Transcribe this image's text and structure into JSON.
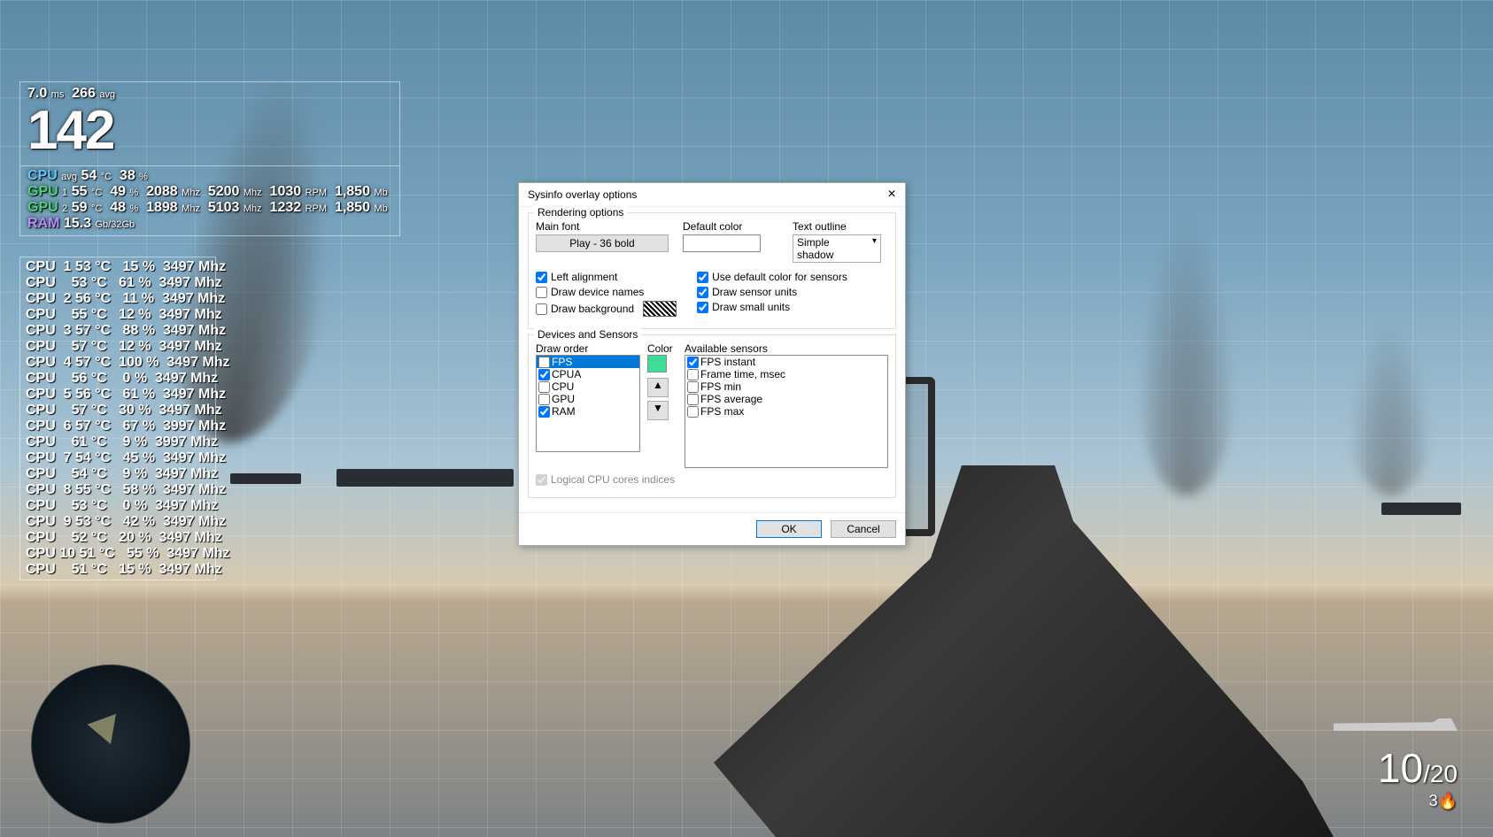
{
  "osd": {
    "frametime": {
      "value": "7.0",
      "unit": "ms",
      "avg": "266",
      "avg_unit": "avg"
    },
    "fps": "142",
    "cpu_avg": {
      "label": "CPU",
      "sub": "avg",
      "temp": "54",
      "temp_u": "°C",
      "load": "38",
      "load_u": "%"
    },
    "gpu1": {
      "label": "GPU",
      "idx": "1",
      "temp": "55",
      "temp_u": "°C",
      "load": "49",
      "load_u": "%",
      "core": "2088",
      "core_u": "Mhz",
      "mem": "5200",
      "mem_u": "Mhz",
      "fan": "1030",
      "fan_u": "RPM",
      "vram": "1,850",
      "vram_u": "Mb"
    },
    "gpu2": {
      "label": "GPU",
      "idx": "2",
      "temp": "59",
      "temp_u": "°C",
      "load": "48",
      "load_u": "%",
      "core": "1898",
      "core_u": "Mhz",
      "mem": "5103",
      "mem_u": "Mhz",
      "fan": "1232",
      "fan_u": "RPM",
      "vram": "1,850",
      "vram_u": "Mb"
    },
    "ram": {
      "label": "RAM",
      "value": "15.3",
      "unit": "Gb/32Gb"
    },
    "cores": [
      {
        "label": "CPU",
        "idx": "1",
        "temp": "53",
        "load": "15",
        "clk": "3497",
        "hot": false
      },
      {
        "label": "CPU",
        "idx": "",
        "temp": "53",
        "load": "61",
        "clk": "3497",
        "hot": false
      },
      {
        "label": "CPU",
        "idx": "2",
        "temp": "56",
        "load": "11",
        "clk": "3497",
        "hot": false
      },
      {
        "label": "CPU",
        "idx": "",
        "temp": "55",
        "load": "12",
        "clk": "3497",
        "hot": false
      },
      {
        "label": "CPU",
        "idx": "3",
        "temp": "57",
        "load": "88",
        "clk": "3497",
        "hot": true
      },
      {
        "label": "CPU",
        "idx": "",
        "temp": "57",
        "load": "12",
        "clk": "3497",
        "hot": false
      },
      {
        "label": "CPU",
        "idx": "4",
        "temp": "57",
        "load": "100",
        "clk": "3497",
        "hot": true
      },
      {
        "label": "CPU",
        "idx": "",
        "temp": "56",
        "load": "0",
        "clk": "3497",
        "hot": false
      },
      {
        "label": "CPU",
        "idx": "5",
        "temp": "56",
        "load": "61",
        "clk": "3497",
        "hot": false
      },
      {
        "label": "CPU",
        "idx": "",
        "temp": "57",
        "load": "30",
        "clk": "3497",
        "hot": false
      },
      {
        "label": "CPU",
        "idx": "6",
        "temp": "57",
        "load": "67",
        "clk": "3997",
        "hot": false
      },
      {
        "label": "CPU",
        "idx": "",
        "temp": "61",
        "load": "9",
        "clk": "3997",
        "hot": false
      },
      {
        "label": "CPU",
        "idx": "7",
        "temp": "54",
        "load": "45",
        "clk": "3497",
        "hot": false
      },
      {
        "label": "CPU",
        "idx": "",
        "temp": "54",
        "load": "9",
        "clk": "3497",
        "hot": false
      },
      {
        "label": "CPU",
        "idx": "8",
        "temp": "55",
        "load": "58",
        "clk": "3497",
        "hot": false
      },
      {
        "label": "CPU",
        "idx": "",
        "temp": "53",
        "load": "0",
        "clk": "3497",
        "hot": false
      },
      {
        "label": "CPU",
        "idx": "9",
        "temp": "53",
        "load": "42",
        "clk": "3497",
        "hot": false
      },
      {
        "label": "CPU",
        "idx": "",
        "temp": "52",
        "load": "20",
        "clk": "3497",
        "hot": false
      },
      {
        "label": "CPU",
        "idx": "10",
        "temp": "51",
        "load": "55",
        "clk": "3497",
        "hot": false
      },
      {
        "label": "CPU",
        "idx": "",
        "temp": "51",
        "load": "15",
        "clk": "3497",
        "hot": false
      }
    ],
    "core_units": {
      "temp": "°C",
      "load": "%",
      "clk": "Mhz"
    }
  },
  "hud": {
    "ammo_current": "10",
    "ammo_sep": "/",
    "ammo_reserve": "20",
    "ammo_sub": "3🔥"
  },
  "dialog": {
    "title": "Sysinfo overlay options",
    "rendering": {
      "legend": "Rendering options",
      "main_font_label": "Main font",
      "main_font_button": "Play - 36 bold",
      "default_color_label": "Default color",
      "outline_label": "Text outline",
      "outline_value": "Simple shadow",
      "chk_left_align": "Left alignment",
      "chk_draw_names": "Draw device names",
      "chk_draw_bg": "Draw background",
      "chk_use_default_color": "Use default color for sensors",
      "chk_sensor_units": "Draw sensor units",
      "chk_small_units": "Draw small units"
    },
    "devices": {
      "legend": "Devices and Sensors",
      "draw_order_label": "Draw order",
      "color_label": "Color",
      "available_label": "Available sensors",
      "order_items": [
        {
          "label": "FPS",
          "checked": false,
          "selected": true
        },
        {
          "label": "CPUA",
          "checked": true,
          "selected": false
        },
        {
          "label": "CPU",
          "checked": false,
          "selected": false
        },
        {
          "label": "GPU",
          "checked": false,
          "selected": false
        },
        {
          "label": "RAM",
          "checked": true,
          "selected": false
        }
      ],
      "available_items": [
        {
          "label": "FPS instant",
          "checked": true
        },
        {
          "label": "Frame time, msec",
          "checked": false
        },
        {
          "label": "FPS min",
          "checked": false
        },
        {
          "label": "FPS average",
          "checked": false
        },
        {
          "label": "FPS max",
          "checked": false
        }
      ],
      "up": "▲",
      "down": "▼",
      "logical_cores": "Logical CPU cores indices"
    },
    "buttons": {
      "ok": "OK",
      "cancel": "Cancel"
    }
  }
}
